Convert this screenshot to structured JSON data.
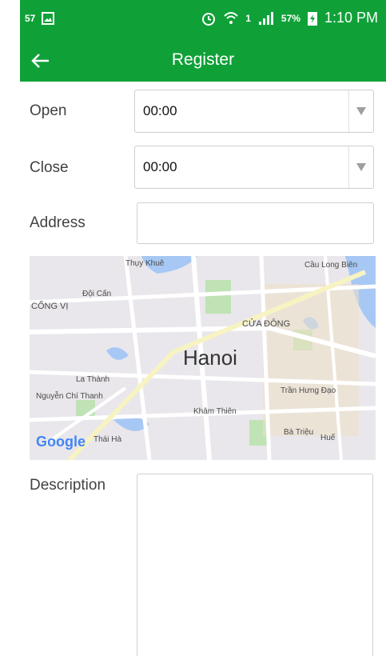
{
  "status_bar": {
    "left_badge": "57",
    "sim": "1",
    "battery": "57%",
    "time": "1:10 PM"
  },
  "app_bar": {
    "title": "Register"
  },
  "form": {
    "open_label": "Open",
    "open_value": "00:00",
    "close_label": "Close",
    "close_value": "00:00",
    "address_label": "Address",
    "address_value": "",
    "description_label": "Description",
    "description_value": ""
  },
  "map": {
    "city": "Hanoi",
    "provider": "Google",
    "labels": {
      "thuy_khue": "Thụy Khuê",
      "cau_long_bien": "Cầu Long Biên",
      "doi_can": "Đội Cấn",
      "cong_vi": "CỐNG VỊ",
      "cua_dong": "CỬA ĐÔNG",
      "la_thanh": "La Thành",
      "tran_hung_dao": "Trần Hưng Đạo",
      "nguyen_chi_thanh": "Nguyễn Chí Thanh",
      "kham_thien": "Khâm Thiên",
      "thai_ha": "Thái Hà",
      "ba_trieu": "Bà Triệu",
      "hue": "Huế"
    }
  },
  "colors": {
    "primary": "#0fa138",
    "border": "#cfcfcf",
    "text": "#424242"
  }
}
